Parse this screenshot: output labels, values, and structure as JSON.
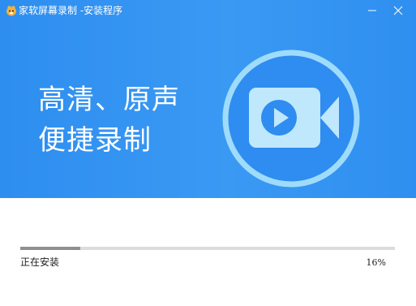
{
  "window": {
    "title": "家软屏幕录制 -安装程序",
    "minimize_icon": "minimize-icon",
    "close_icon": "close-icon"
  },
  "hero": {
    "slogan_line1": "高清、原声",
    "slogan_line2": "便捷录制",
    "graphic": "video-camera-icon",
    "background_color": "#3393f2"
  },
  "progress": {
    "status": "正在安装",
    "percent_text": "16%",
    "value": 0.16
  }
}
